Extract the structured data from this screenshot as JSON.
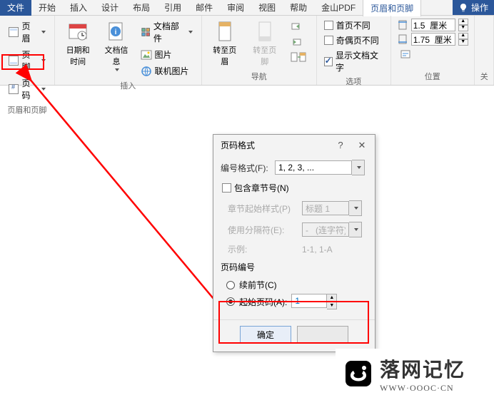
{
  "menu": {
    "file": "文件",
    "start": "开始",
    "insert": "插入",
    "design": "设计",
    "layout": "布局",
    "reference": "引用",
    "mail": "邮件",
    "review": "审阅",
    "view": "视图",
    "help": "帮助",
    "wps_pdf": "金山PDF",
    "header_footer_tab": "页眉和页脚",
    "tell": "操作"
  },
  "ribbon": {
    "group1": {
      "header": "页眉和页脚",
      "header_btn": "页眉",
      "footer_btn": "页脚",
      "page_number_btn": "页码"
    },
    "group_insert": {
      "datetime": "日期和时间",
      "docinfo": "文档信息",
      "docparts": "文档部件",
      "picture": "图片",
      "online_pic": "联机图片",
      "label": "插入"
    },
    "group_nav": {
      "goto_header": "转至页眉",
      "goto_footer": "转至页脚",
      "label": "导航"
    },
    "group_options": {
      "first_diff": "首页不同",
      "odd_even_diff": "奇偶页不同",
      "show_doc_text": "显示文档文字",
      "label": "选项"
    },
    "group_position": {
      "top_margin": "1.5  厘米",
      "bot_margin": "1.75  厘米",
      "label": "位置"
    },
    "group_close": {
      "label": "关"
    }
  },
  "dialog": {
    "title": "页码格式",
    "number_format_label": "编号格式(F):",
    "number_format_value": "1, 2, 3, ...",
    "include_chapter": "包含章节号(N)",
    "chapter_start_style_label": "章节起始样式(P)",
    "chapter_start_style_value": "标题 1",
    "separator_label": "使用分隔符(E):",
    "separator_value": "-   (连字符)",
    "example_label": "示例:",
    "example_value": "1-1, 1-A",
    "page_numbering": "页码编号",
    "continue_prev": "续前节(C)",
    "start_at": "起始页码(A):",
    "start_value": "1",
    "ok": "确定",
    "cancel": ""
  },
  "logo": {
    "text": "落网记忆",
    "url": "WWW·OOOC·CN"
  }
}
